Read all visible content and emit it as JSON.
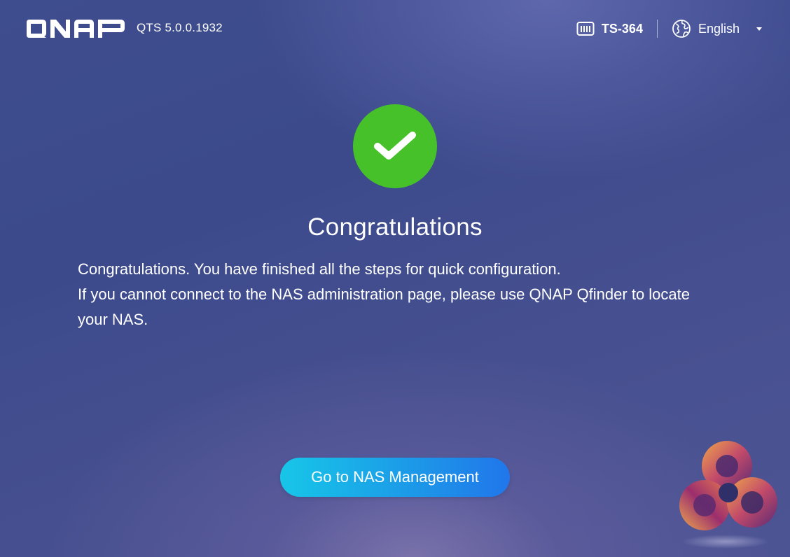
{
  "header": {
    "logo_text": "QNAP",
    "version": "QTS 5.0.0.1932",
    "model": {
      "label": "TS-364",
      "icon": "nas-device-icon"
    },
    "language": {
      "label": "English",
      "icon": "globe-icon",
      "caret_icon": "caret-down-icon"
    }
  },
  "main": {
    "status_icon": "checkmark-icon",
    "title": "Congratulations",
    "message_lines": [
      "Congratulations. You have finished all the steps for quick configuration.",
      "If you cannot connect to the NAS administration page, please use QNAP Qfinder to locate your NAS."
    ],
    "primary_button": "Go to NAS Management"
  },
  "colors": {
    "success": "#46c12a",
    "button_gradient_start": "#17c6e8",
    "button_gradient_end": "#2176ea",
    "background": "#3e4d8e"
  }
}
